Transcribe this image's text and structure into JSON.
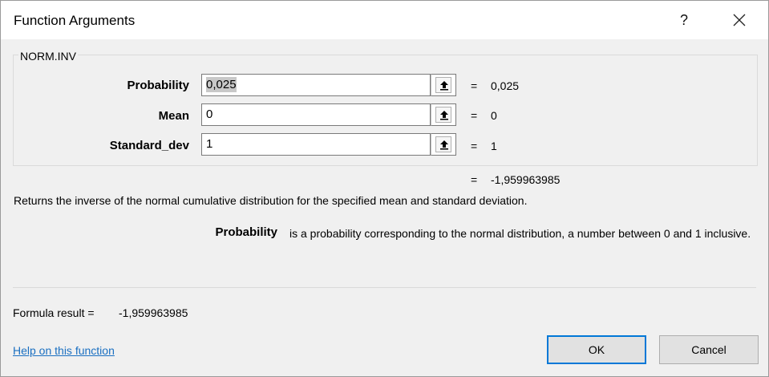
{
  "dialog": {
    "title": "Function Arguments",
    "help_glyph": "?",
    "function_name": "NORM.INV"
  },
  "arguments": [
    {
      "label": "Probability",
      "value": "0,025",
      "result": "0,025"
    },
    {
      "label": "Mean",
      "value": "0",
      "result": "0"
    },
    {
      "label": "Standard_dev",
      "value": "1",
      "result": "1"
    }
  ],
  "equals_sign": "=",
  "function_result": "-1,959963985",
  "description": "Returns the inverse of the normal cumulative distribution for the specified mean and standard deviation.",
  "param_help": {
    "name": "Probability",
    "text": "is a probability corresponding to the normal distribution, a number between 0 and 1 inclusive."
  },
  "formula": {
    "label": "Formula result =",
    "value": "-1,959963985"
  },
  "footer": {
    "help_link": "Help on this function",
    "ok_label": "OK",
    "cancel_label": "Cancel"
  },
  "icons": {
    "collapse": "collapse-dialog-icon",
    "close": "close-icon"
  }
}
